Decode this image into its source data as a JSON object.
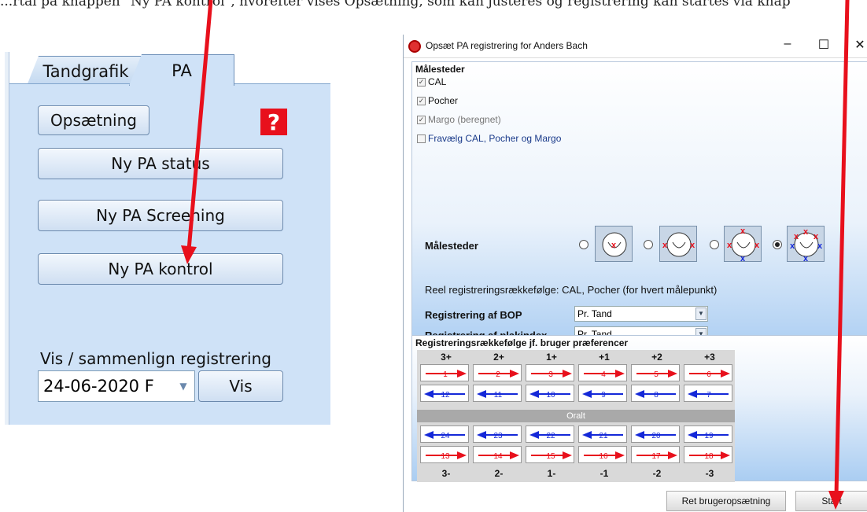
{
  "top_caption": "...rtal på knappen \"Ny PA kontrol\", hvorefter vises Opsætning, som kan justeres og registrering kan startes via knap",
  "left_panel": {
    "tabs": [
      {
        "label": "Tandgrafik"
      },
      {
        "label": "PA"
      }
    ],
    "setup_label": "Opsætning",
    "help_label": "?",
    "new_status_label": "Ny PA status",
    "new_screening_label": "Ny PA Screening",
    "new_control_label": "Ny PA kontrol",
    "compare_label": "Vis / sammenlign registrering",
    "date_value": "24-06-2020  F",
    "show_label": "Vis"
  },
  "dialog": {
    "title": "Opsæt PA registrering for Anders Bach",
    "section1_title": "Målesteder",
    "checkboxes": [
      {
        "label": "CAL",
        "checked": true
      },
      {
        "label": "Pocher",
        "checked": true
      },
      {
        "label": "Margo (beregnet)",
        "checked": true
      },
      {
        "label": "Fravælg CAL, Pocher og Margo",
        "checked": false
      }
    ],
    "measure_label": "Målesteder",
    "selected_option": 4,
    "reel_text": "Reel registreringsrækkefølge: CAL, Pocher (for hvert målepunkt)",
    "bop_label": "Registrering af BOP",
    "bop_value": "Pr. Tand",
    "plak_label": "Registrering af plakindex",
    "plak_value": "Pr. Tand",
    "section2_title": "Registreringsrækkefølge jf. bruger præferencer",
    "upper_headers": [
      "3+",
      "2+",
      "1+",
      "+1",
      "+2",
      "+3"
    ],
    "lower_headers": [
      "3-",
      "2-",
      "1-",
      "-1",
      "-2",
      "-3"
    ],
    "row1": [
      "1",
      "2",
      "3",
      "4",
      "5",
      "6"
    ],
    "row2": [
      "12",
      "11",
      "10",
      "9",
      "8",
      "7"
    ],
    "oralt_label": "Oralt",
    "row3": [
      "24",
      "23",
      "22",
      "21",
      "20",
      "19"
    ],
    "row4": [
      "13",
      "14",
      "15",
      "16",
      "17",
      "18"
    ],
    "reset_button": "Ret brugeropsætning",
    "start_button": "Start",
    "colors": {
      "red": "#e8101c",
      "blue": "#1428d8"
    }
  }
}
